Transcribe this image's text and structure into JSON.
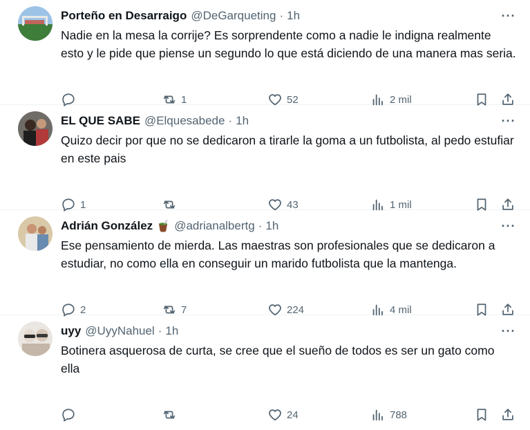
{
  "tweets": [
    {
      "name": "Porteño en Desarraigo",
      "emoji": "",
      "handle": "@DeGarqueting",
      "separator": "·",
      "time": "1h",
      "text": "Nadie en la mesa la corrije? Es sorprendente como a nadie le indigna realmente esto y le pide que piense un segundo lo que está diciendo de una manera mas seria.",
      "replies": "",
      "retweets": "1",
      "likes": "52",
      "views": "2 mil"
    },
    {
      "name": "EL QUE SABE",
      "emoji": "",
      "handle": "@Elquesabede",
      "separator": "·",
      "time": "1h",
      "text": "Quizo decir por que no se dedicaron a tirarle la goma a un futbolista, al pedo estufiar en este pais",
      "replies": "1",
      "retweets": "",
      "likes": "43",
      "views": "1 mil"
    },
    {
      "name": "Adrián González",
      "emoji": "mate-emoji",
      "handle": "@adrianalbertg",
      "separator": "·",
      "time": "1h",
      "text": "Ese pensamiento de mierda. Las maestras son profesionales que se dedicaron a estudiar, no como ella en conseguir un marido futbolista que la mantenga.",
      "replies": "2",
      "retweets": "7",
      "likes": "224",
      "views": "4 mil"
    },
    {
      "name": "uyy",
      "emoji": "",
      "handle": "@UyyNahuel",
      "separator": "·",
      "time": "1h",
      "text": "Botinera asquerosa de curta, se cree que el sueño de todos es ser un gato como ella",
      "replies": "",
      "retweets": "",
      "likes": "24",
      "views": "788"
    }
  ],
  "more_label": "···",
  "colors": {
    "text": "#0f1419",
    "secondary": "#536471",
    "divider": "#eff3f4"
  }
}
